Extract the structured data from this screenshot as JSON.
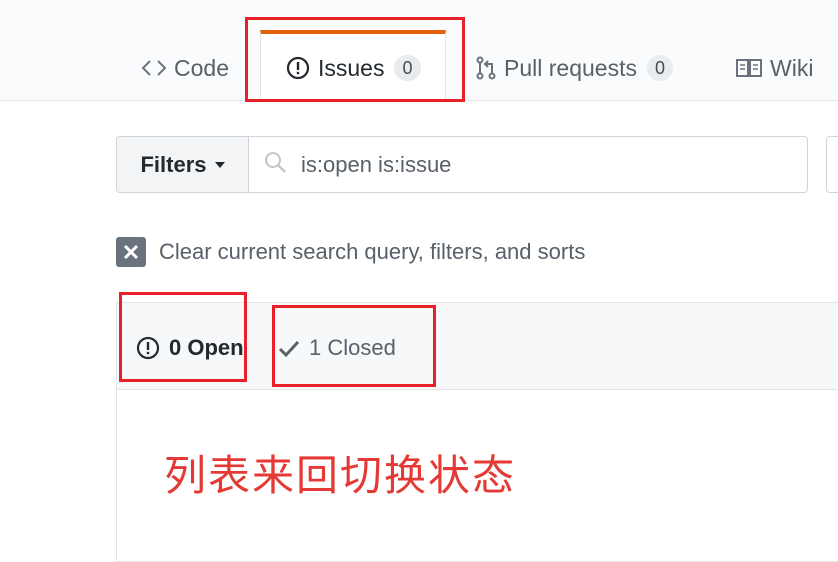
{
  "tabs": {
    "code_label": "Code",
    "issues_label": "Issues",
    "issues_count": "0",
    "pulls_label": "Pull requests",
    "pulls_count": "0",
    "wiki_label": "Wiki"
  },
  "filters": {
    "button_label": "Filters",
    "search_value": "is:open is:issue"
  },
  "clear": {
    "label": "Clear current search query, filters, and sorts"
  },
  "states": {
    "open_label": "0 Open",
    "closed_label": "1 Closed"
  },
  "annotation": {
    "text": "列表来回切换状态",
    "color": "#e8202a"
  },
  "colors": {
    "active_tab_accent": "#e36209",
    "annotation_red": "#e8202a"
  }
}
